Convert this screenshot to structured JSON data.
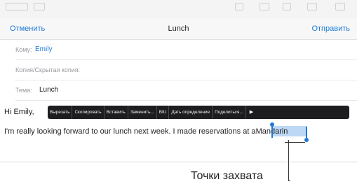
{
  "header": {
    "cancel_label": "Отменить",
    "title": "Lunch",
    "send_label": "Отправить"
  },
  "fields": {
    "to_label": "Кому:",
    "to_value": "Emily",
    "cc_label": "Копия/Скрытая копия:",
    "subject_label": "Тема:",
    "subject_value": "Lunch"
  },
  "body": {
    "greeting": "Hi Emily,",
    "line_before_selection": "I'm really looking forward to our lunch next week. I made reservations at a",
    "selected_word": "Mandarin"
  },
  "edit_menu": {
    "items": [
      "Вырезать",
      "Скопировать",
      "Вставить",
      "Заменить...",
      "BIU",
      "Дать определение",
      "Поделиться..."
    ],
    "more_icon": "right-arrow-icon"
  },
  "callout": {
    "label": "Точки захвата"
  },
  "colors": {
    "accent": "#1f7ad6",
    "selection": "#bcd8f5",
    "menu_bg": "#1d1d1f"
  }
}
